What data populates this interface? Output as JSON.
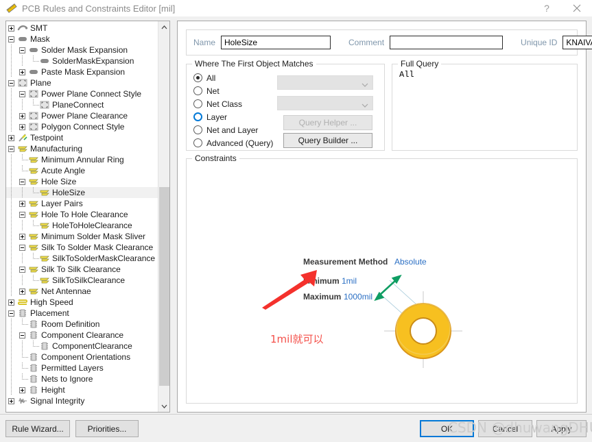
{
  "window": {
    "title": "PCB Rules and Constraints Editor [mil]",
    "icon": "pcb-ruler-icon",
    "help_label": "?",
    "close_label": "✕"
  },
  "tree": {
    "items": [
      {
        "label": "SMT",
        "indent": 0,
        "toggle": "plus",
        "icon": "smt-icon",
        "selected": false
      },
      {
        "label": "Mask",
        "indent": 0,
        "toggle": "minus",
        "icon": "mask-icon",
        "selected": false
      },
      {
        "label": "Solder Mask Expansion",
        "indent": 1,
        "toggle": "minus",
        "icon": "mask-icon",
        "selected": false
      },
      {
        "label": "SolderMaskExpansion",
        "indent": 2,
        "toggle": "none",
        "icon": "mask-icon",
        "selected": false
      },
      {
        "label": "Paste Mask Expansion",
        "indent": 1,
        "toggle": "plus",
        "icon": "mask-icon",
        "selected": false
      },
      {
        "label": "Plane",
        "indent": 0,
        "toggle": "minus",
        "icon": "plane-icon",
        "selected": false
      },
      {
        "label": "Power Plane Connect Style",
        "indent": 1,
        "toggle": "minus",
        "icon": "plane-icon",
        "selected": false
      },
      {
        "label": "PlaneConnect",
        "indent": 2,
        "toggle": "none",
        "icon": "plane-icon",
        "selected": false
      },
      {
        "label": "Power Plane Clearance",
        "indent": 1,
        "toggle": "plus",
        "icon": "plane-icon",
        "selected": false
      },
      {
        "label": "Polygon Connect Style",
        "indent": 1,
        "toggle": "plus",
        "icon": "plane-icon",
        "selected": false
      },
      {
        "label": "Testpoint",
        "indent": 0,
        "toggle": "plus",
        "icon": "testpoint-icon",
        "selected": false
      },
      {
        "label": "Manufacturing",
        "indent": 0,
        "toggle": "minus",
        "icon": "manufacturing-icon",
        "selected": false
      },
      {
        "label": "Minimum Annular Ring",
        "indent": 1,
        "toggle": "none",
        "icon": "manufacturing-icon",
        "selected": false
      },
      {
        "label": "Acute Angle",
        "indent": 1,
        "toggle": "none",
        "icon": "manufacturing-icon",
        "selected": false
      },
      {
        "label": "Hole Size",
        "indent": 1,
        "toggle": "minus",
        "icon": "manufacturing-icon",
        "selected": false
      },
      {
        "label": "HoleSize",
        "indent": 2,
        "toggle": "none",
        "icon": "manufacturing-icon",
        "selected": true
      },
      {
        "label": "Layer Pairs",
        "indent": 1,
        "toggle": "plus",
        "icon": "manufacturing-icon",
        "selected": false
      },
      {
        "label": "Hole To Hole Clearance",
        "indent": 1,
        "toggle": "minus",
        "icon": "manufacturing-icon",
        "selected": false
      },
      {
        "label": "HoleToHoleClearance",
        "indent": 2,
        "toggle": "none",
        "icon": "manufacturing-icon",
        "selected": false
      },
      {
        "label": "Minimum Solder Mask Sliver",
        "indent": 1,
        "toggle": "plus",
        "icon": "manufacturing-icon",
        "selected": false
      },
      {
        "label": "Silk To Solder Mask Clearance",
        "indent": 1,
        "toggle": "minus",
        "icon": "manufacturing-icon",
        "selected": false
      },
      {
        "label": "SilkToSolderMaskClearance",
        "indent": 2,
        "toggle": "none",
        "icon": "manufacturing-icon",
        "selected": false
      },
      {
        "label": "Silk To Silk Clearance",
        "indent": 1,
        "toggle": "minus",
        "icon": "manufacturing-icon",
        "selected": false
      },
      {
        "label": "SilkToSilkClearance",
        "indent": 2,
        "toggle": "none",
        "icon": "manufacturing-icon",
        "selected": false
      },
      {
        "label": "Net Antennae",
        "indent": 1,
        "toggle": "plus",
        "icon": "manufacturing-icon",
        "selected": false
      },
      {
        "label": "High Speed",
        "indent": 0,
        "toggle": "plus",
        "icon": "highspeed-icon",
        "selected": false
      },
      {
        "label": "Placement",
        "indent": 0,
        "toggle": "minus",
        "icon": "placement-icon",
        "selected": false
      },
      {
        "label": "Room Definition",
        "indent": 1,
        "toggle": "none",
        "icon": "placement-icon",
        "selected": false
      },
      {
        "label": "Component Clearance",
        "indent": 1,
        "toggle": "minus",
        "icon": "placement-icon",
        "selected": false
      },
      {
        "label": "ComponentClearance",
        "indent": 2,
        "toggle": "none",
        "icon": "placement-icon",
        "selected": false
      },
      {
        "label": "Component Orientations",
        "indent": 1,
        "toggle": "none",
        "icon": "placement-icon",
        "selected": false
      },
      {
        "label": "Permitted Layers",
        "indent": 1,
        "toggle": "none",
        "icon": "placement-icon",
        "selected": false
      },
      {
        "label": "Nets to Ignore",
        "indent": 1,
        "toggle": "none",
        "icon": "placement-icon",
        "selected": false
      },
      {
        "label": "Height",
        "indent": 1,
        "toggle": "plus",
        "icon": "placement-icon",
        "selected": false
      },
      {
        "label": "Signal Integrity",
        "indent": 0,
        "toggle": "plus",
        "icon": "signalintegrity-icon",
        "selected": false
      }
    ],
    "scrollbar": {
      "up_icon": "chevron-up-icon",
      "down_icon": "chevron-down-icon"
    }
  },
  "form": {
    "name_label": "Name",
    "name_value": "HoleSize",
    "comment_label": "Comment",
    "comment_value": "",
    "unique_id_label": "Unique ID",
    "unique_id_value": "KNAIVAJQ"
  },
  "where": {
    "title": "Where The First Object Matches",
    "options": [
      {
        "label": "All",
        "selected": true,
        "hover": false
      },
      {
        "label": "Net",
        "selected": false,
        "hover": false
      },
      {
        "label": "Net Class",
        "selected": false,
        "hover": false
      },
      {
        "label": "Layer",
        "selected": false,
        "hover": true
      },
      {
        "label": "Net and Layer",
        "selected": false,
        "hover": false
      },
      {
        "label": "Advanced (Query)",
        "selected": false,
        "hover": false
      }
    ],
    "net_combo_value": "",
    "netclass_combo_value": "",
    "query_helper_label": "Query Helper ...",
    "query_builder_label": "Query Builder ..."
  },
  "full_query": {
    "title": "Full Query",
    "text": "All"
  },
  "constraints": {
    "title": "Constraints",
    "measurement_method_label": "Measurement Method",
    "measurement_method_value": "Absolute",
    "minimum_label": "Minimum",
    "minimum_value": "1mil",
    "maximum_label": "Maximum",
    "maximum_value": "1000mil",
    "annotation_text": "1mil就可以",
    "annotation_color": "#f4504a",
    "diagram_name": "hole-size-donut-diagram"
  },
  "footer": {
    "rule_wizard_label": "Rule Wizard...",
    "priorities_label": "Priorities...",
    "ok_label": "OK",
    "cancel_label": "Cancel",
    "apply_label": "Apply"
  },
  "watermark": {
    "text": "CSDN @dhuwangDHU"
  }
}
